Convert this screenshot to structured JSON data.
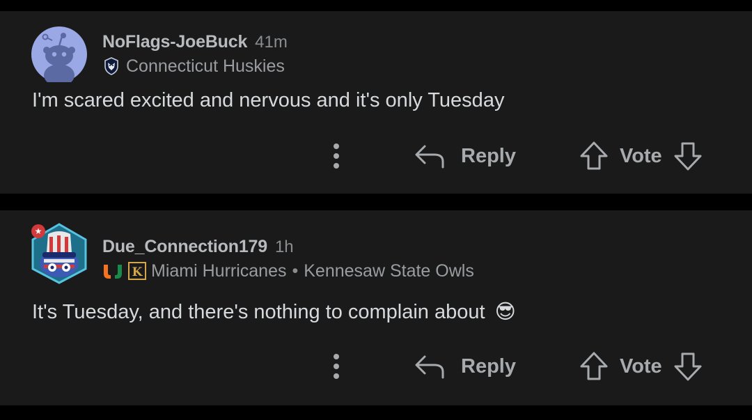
{
  "comments": [
    {
      "username": "NoFlags-JoeBuck",
      "time": "41m",
      "flairs": [
        "Connecticut Huskies"
      ],
      "body": "I'm scared excited and nervous and it's only Tuesday",
      "avatar_icon": "snoo-default-avatar",
      "reply_label": "Reply",
      "vote_label": "Vote"
    },
    {
      "username": "Due_Connection179",
      "time": "1h",
      "flairs": [
        "Miami Hurricanes",
        "Kennesaw State Owls"
      ],
      "flair_separator": "•",
      "body": "It's Tuesday, and there's nothing to complain about",
      "body_emoji": "😎",
      "avatar_icon": "uncle-sam-ball-avatar",
      "reply_label": "Reply",
      "vote_label": "Vote"
    }
  ],
  "colors": {
    "page_background": "#000000",
    "card_background": "#1a1a1b",
    "text_primary": "#d7dadc",
    "text_meta": "#8b8e91",
    "miami_orange": "#f47321",
    "miami_green": "#005030",
    "kennesaw_gold": "#d6a64a"
  }
}
